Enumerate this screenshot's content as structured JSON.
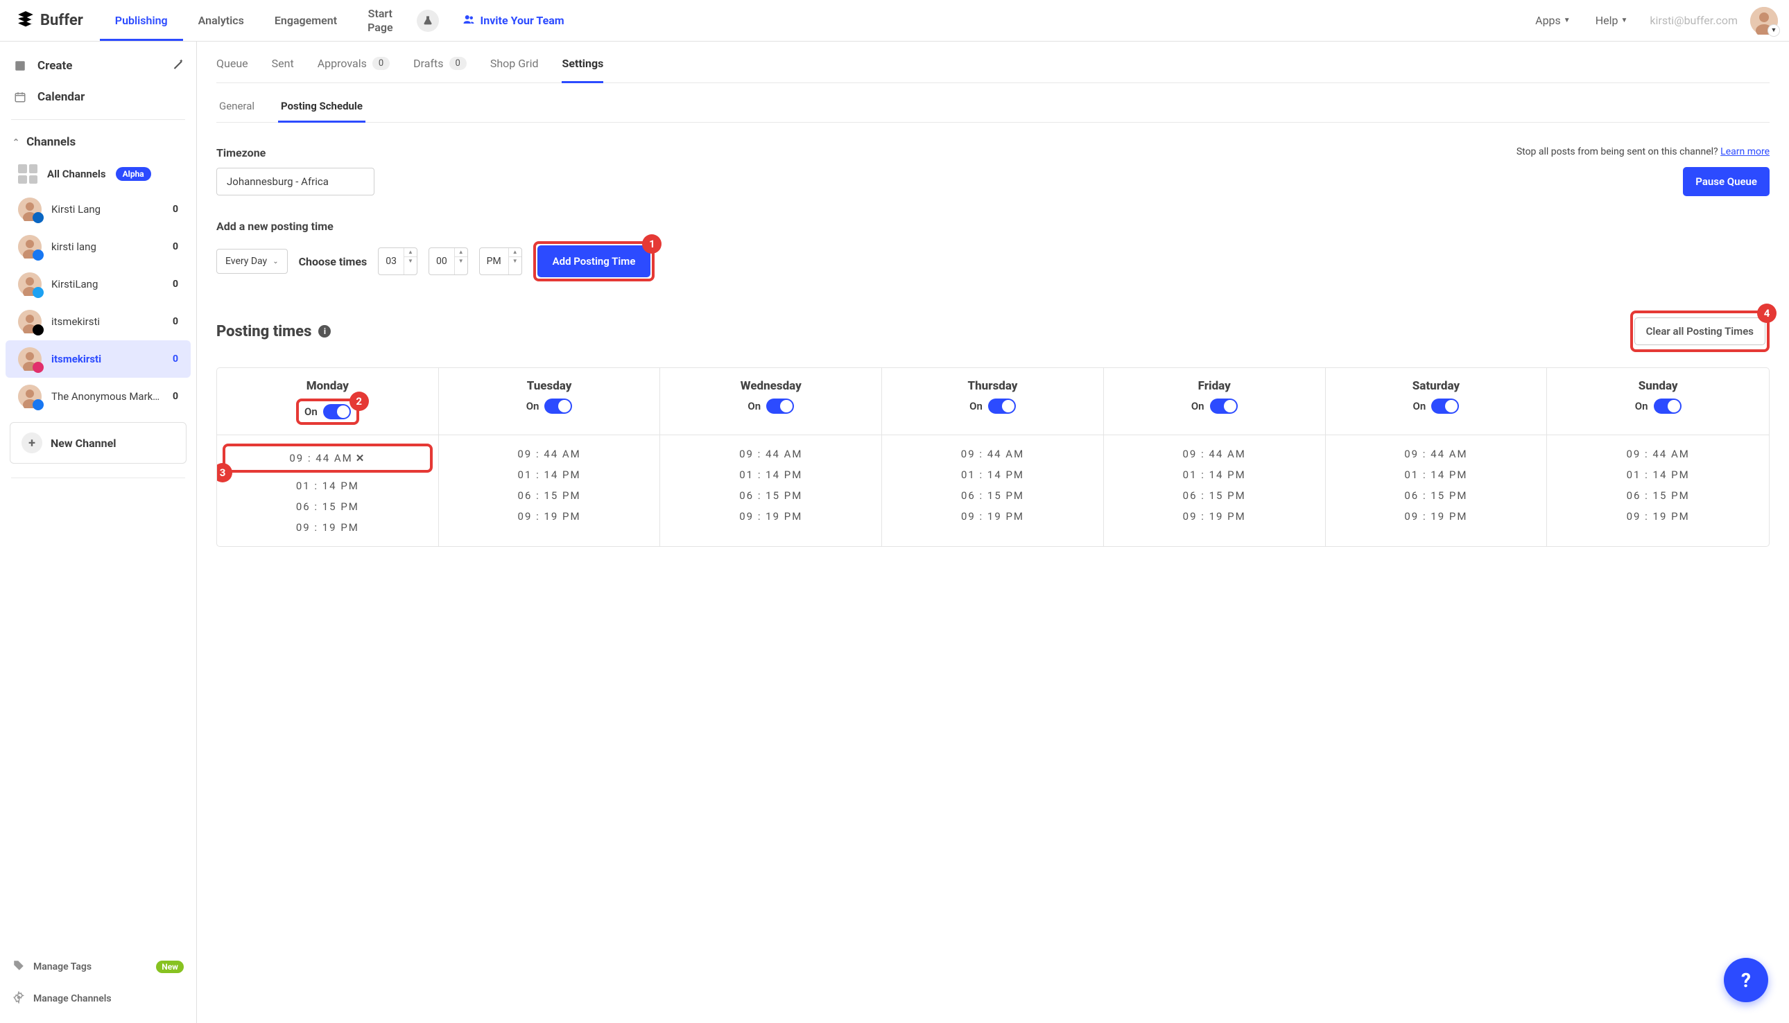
{
  "brand": "Buffer",
  "topnav": {
    "items": [
      "Publishing",
      "Analytics",
      "Engagement",
      "Start\nPage"
    ],
    "active": "Publishing",
    "invite": "Invite Your Team",
    "apps": "Apps",
    "help": "Help",
    "email": "kirsti@buffer.com"
  },
  "sidebar": {
    "create": "Create",
    "calendar": "Calendar",
    "channels_label": "Channels",
    "all_channels": "All Channels",
    "alpha": "Alpha",
    "channels": [
      {
        "name": "Kirsti Lang",
        "count": "0",
        "network": "linkedin"
      },
      {
        "name": "kirsti lang",
        "count": "0",
        "network": "fb"
      },
      {
        "name": "KirstiLang",
        "count": "0",
        "network": "twitter"
      },
      {
        "name": "itsmekirsti",
        "count": "0",
        "network": "tiktok"
      },
      {
        "name": "itsmekirsti",
        "count": "0",
        "network": "instagram",
        "selected": true
      },
      {
        "name": "The Anonymous Marke…",
        "count": "0",
        "network": "fb"
      }
    ],
    "new_channel": "New Channel",
    "manage_tags": "Manage Tags",
    "new_pill": "New",
    "manage_channels": "Manage Channels"
  },
  "tabs": {
    "items": [
      {
        "label": "Queue"
      },
      {
        "label": "Sent"
      },
      {
        "label": "Approvals",
        "count": "0"
      },
      {
        "label": "Drafts",
        "count": "0"
      },
      {
        "label": "Shop Grid"
      },
      {
        "label": "Settings",
        "active": true
      }
    ],
    "sub": [
      {
        "label": "General"
      },
      {
        "label": "Posting Schedule",
        "active": true
      }
    ]
  },
  "timezone": {
    "label": "Timezone",
    "value": "Johannesburg - Africa",
    "stop_text": "Stop all posts from being sent on this channel?",
    "learn": "Learn more",
    "pause": "Pause Queue"
  },
  "addtime": {
    "label": "Add a new posting time",
    "every": "Every Day",
    "choose": "Choose times",
    "hh": "03",
    "mm": "00",
    "ampm": "PM",
    "btn": "Add Posting Time"
  },
  "posting": {
    "title": "Posting times",
    "clear": "Clear all Posting Times",
    "days": [
      "Monday",
      "Tuesday",
      "Wednesday",
      "Thursday",
      "Friday",
      "Saturday",
      "Sunday"
    ],
    "on": "On",
    "times": [
      "09 : 44  AM",
      "01 : 14  PM",
      "06 : 15  PM",
      "09 : 19  PM"
    ]
  },
  "anno": {
    "1": "1",
    "2": "2",
    "3": "3",
    "4": "4"
  }
}
